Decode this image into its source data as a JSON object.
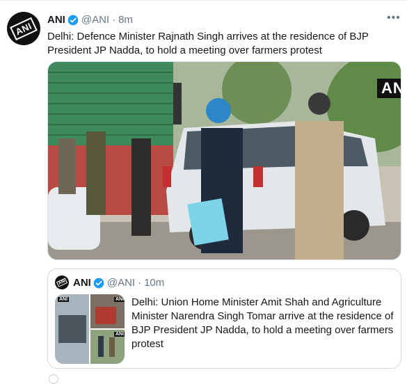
{
  "tweet": {
    "account_name": "ANI",
    "handle": "@ANI",
    "time": "8m",
    "more_label": "•••",
    "text": "Delhi: Defence Minister Rajnath Singh arrives at the residence of BJP President JP Nadda, to hold a meeting over farmers protest",
    "photo_watermark": "ANI",
    "avatar_logo": "ANI"
  },
  "quote": {
    "account_name": "ANI",
    "handle": "@ANI",
    "time": "10m",
    "text": "Delhi: Union Home Minister Amit Shah and Agriculture Minister Narendra Singh Tomar arrive at the residence of BJP President JP Nadda, to hold a meeting over farmers protest",
    "thumb_watermark": "ANI",
    "avatar_logo": "ANI"
  },
  "colors": {
    "verified_blue": "#1d9bf0",
    "text_primary": "#14171a",
    "text_muted": "#657786",
    "border": "#cfd9de"
  },
  "icons": [
    "verified-badge-icon",
    "more-options-icon"
  ]
}
